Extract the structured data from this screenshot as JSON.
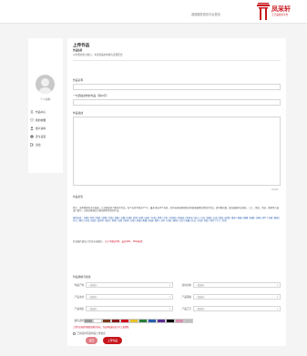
{
  "header": {
    "top_link": "返回服务首页平台首页",
    "brand": "凤采轩",
    "brand_sub": "工艺品交易平台",
    "colors": {
      "brand_red": "#c8161d"
    }
  },
  "sidebar": {
    "avatar_label": "个人资料",
    "items": [
      {
        "label": "作品中心",
        "icon": "user-icon"
      },
      {
        "label": "我的收藏",
        "icon": "heart-icon"
      },
      {
        "label": "账户资料",
        "icon": "person-icon"
      },
      {
        "label": "安全设置",
        "icon": "settings-icon"
      },
      {
        "label": "退出",
        "icon": "logout-icon"
      }
    ]
  },
  "main": {
    "title": "上传作品",
    "subtitle": "作品信息",
    "description": "以中国文化为核心，丰富作品的内涵与表现形式",
    "name_label": "作品名称",
    "name_placeholder": "",
    "keywords_label": "一句话描述你的作品（限20字）",
    "keywords_placeholder": "",
    "intro_label": "作品描述",
    "intro_placeholder": "",
    "counter": "0/1000",
    "tags_label": "作品标签",
    "para1": "提示：请用精简的语言描述，让买家更快了解您的作品。每个标签不超过6个字，最多添加10个标签。好的标签能够帮助买家更准确地找到您的作品，提升曝光量。建议根据作品材质、工艺、风格、用途、题材等方面进行填写，以便买家通过关键词搜索到您的作品。",
    "para2": "推荐标签：刺绣 | 剪纸 | 陶瓷 | 木雕 | 竹编 | 漆器 | 玉雕 | 石雕 | 泥塑 | 面塑 | 皮影 | 年画 | 风筝 | 灯彩 | 中国结 | 景泰蓝 | 紫砂壶 | 唐卡 | 书法 | 国画 | 扎染 | 蜡染 | 织锦 | 银饰 | 铜器 | 根雕 | 核雕 | 牙雕 | 葫芦 | 草编 | 藤编 | 布艺 | 香包 | 折扇 | 团扇 | 油纸伞 | 砚台 | 毛笔 | 宣纸 | 篆刻 | 印章 | 茶器 | 香器 | 花器 | 摆件 | 挂件 | 首饰 | 家居 | 文房 | 收藏 | 礼品 | 定制 | 传统 | 现代 | 手工 | 非遗",
    "note": "作品图片建议上传正方形图片，",
    "note_red": "大小不超过5M，支持JPG、PNG格式",
    "attributes": {
      "title": "作品规格与属性",
      "fields": [
        {
          "label": "作品产地",
          "value": "--请选择--"
        },
        {
          "label": "适用对象",
          "value": "--请选择--"
        },
        {
          "label": "产品主材",
          "value": "--请选择--"
        },
        {
          "label": "产品风格",
          "value": "--请选择--"
        },
        {
          "label": "产品用途",
          "value": "--请选择--"
        },
        {
          "label": "产品工艺",
          "value": "--请选择--"
        }
      ],
      "color_label": "颜色选择",
      "swatch_colors": [
        "#999999",
        "#ffffff",
        "#7a3b1c",
        "#8a1a1a",
        "#d0021b",
        "#e6c229",
        "#2a7f3a",
        "#2a5db0",
        "#5c2d91",
        "#000000",
        "#d98fb0",
        "#c0c0c0"
      ],
      "hint": "上传作品前请仔细阅读相关协议，作品审核通过后方可上架销售。",
      "agree": "已阅读并同意作品上传协议",
      "back_button": "返回",
      "upload_button": "上传作品"
    }
  }
}
